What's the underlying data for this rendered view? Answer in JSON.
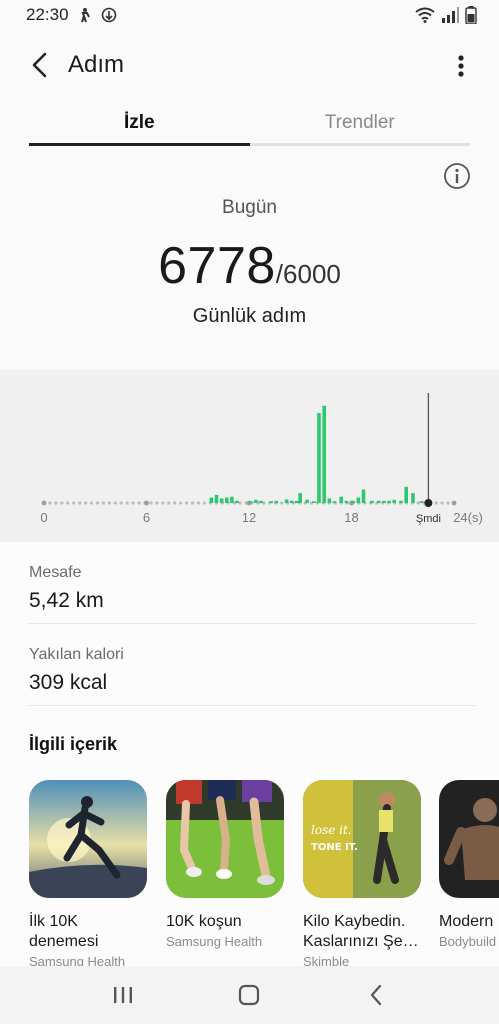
{
  "status_bar": {
    "time": "22:30",
    "icons": [
      "person-walk-icon",
      "data-saver-icon",
      "wifi-icon",
      "signal-icon",
      "battery-icon"
    ]
  },
  "header": {
    "title": "Adım",
    "back_icon": "chevron-left-icon",
    "menu_icon": "more-vertical-icon"
  },
  "tabs": [
    {
      "label": "İzle",
      "active": true
    },
    {
      "label": "Trendler",
      "active": false
    }
  ],
  "summary": {
    "period_label": "Bugün",
    "steps": "6778",
    "goal": "/6000",
    "caption": "Günlük adım"
  },
  "chart_data": {
    "type": "bar",
    "title": "",
    "x_tick_labels": [
      "0",
      "6",
      "12",
      "18",
      "Şmdi",
      "24(s)"
    ],
    "x_tick_positions": [
      0,
      6,
      12,
      18,
      22.5,
      24
    ],
    "now_marker_hour": 22.5,
    "xlim": [
      0,
      24
    ],
    "ylim": [
      0,
      1200
    ],
    "values": [
      {
        "x": 9.8,
        "y": 60
      },
      {
        "x": 10.1,
        "y": 90
      },
      {
        "x": 10.4,
        "y": 50
      },
      {
        "x": 10.7,
        "y": 60
      },
      {
        "x": 11.0,
        "y": 70
      },
      {
        "x": 11.3,
        "y": 25
      },
      {
        "x": 12.1,
        "y": 20
      },
      {
        "x": 12.4,
        "y": 35
      },
      {
        "x": 12.7,
        "y": 25
      },
      {
        "x": 13.3,
        "y": 20
      },
      {
        "x": 13.6,
        "y": 25
      },
      {
        "x": 14.2,
        "y": 40
      },
      {
        "x": 14.5,
        "y": 25
      },
      {
        "x": 14.8,
        "y": 25
      },
      {
        "x": 15.0,
        "y": 110
      },
      {
        "x": 15.4,
        "y": 35
      },
      {
        "x": 15.8,
        "y": 20
      },
      {
        "x": 16.1,
        "y": 1000
      },
      {
        "x": 16.4,
        "y": 1080
      },
      {
        "x": 16.7,
        "y": 50
      },
      {
        "x": 17.0,
        "y": 20
      },
      {
        "x": 17.4,
        "y": 70
      },
      {
        "x": 17.7,
        "y": 25
      },
      {
        "x": 18.1,
        "y": 25
      },
      {
        "x": 18.4,
        "y": 60
      },
      {
        "x": 18.7,
        "y": 150
      },
      {
        "x": 19.2,
        "y": 25
      },
      {
        "x": 19.6,
        "y": 25
      },
      {
        "x": 19.9,
        "y": 25
      },
      {
        "x": 20.2,
        "y": 25
      },
      {
        "x": 20.5,
        "y": 35
      },
      {
        "x": 20.9,
        "y": 25
      },
      {
        "x": 21.2,
        "y": 180
      },
      {
        "x": 21.6,
        "y": 110
      },
      {
        "x": 22.1,
        "y": 20
      }
    ],
    "bar_color": "#2dc76d",
    "now_line_color": "#555555"
  },
  "stats": [
    {
      "label": "Mesafe",
      "value": "5,42 km"
    },
    {
      "label": "Yakılan kalori",
      "value": "309 kcal"
    }
  ],
  "related": {
    "title": "İlgili içerik",
    "cards": [
      {
        "title": "İlk 10K\ndenemesi",
        "source": "Samsung Health",
        "thumb": "runner-sunset-image"
      },
      {
        "title": "10K koşun",
        "source": "Samsung Health",
        "thumb": "runners-legs-image"
      },
      {
        "title": "Kilo Kaybedin.\nKaslarınızı Şe…",
        "source": "Skimble",
        "thumb": "lose-it-tone-it-image",
        "thumb_text_1": "lose it.",
        "thumb_text_2": "TONE IT."
      },
      {
        "title": "Modern",
        "source": "Bodybuild",
        "thumb": "muscle-man-image"
      }
    ]
  },
  "nav": {
    "items": [
      "recent-apps-icon",
      "home-icon",
      "back-icon"
    ]
  }
}
